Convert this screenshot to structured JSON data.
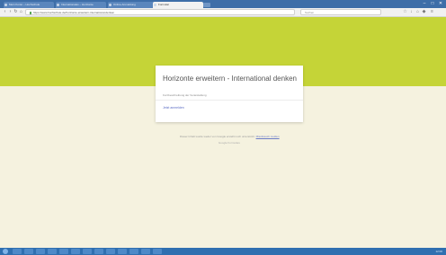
{
  "browser": {
    "tabs": [
      {
        "label": "Mein Konto – Hochschule"
      },
      {
        "label": "Internationales – Horizonte"
      },
      {
        "label": "Online-Anmeldung"
      },
      {
        "label": "Formular"
      }
    ],
    "window_controls": [
      "–",
      "□",
      "✕"
    ],
    "address": "https://www.hochschule.de/horizonte-erweitern-international-denken",
    "search_placeholder": "Suchen",
    "nav_icons": [
      "back-icon",
      "forward-icon",
      "reload-icon",
      "home-icon"
    ]
  },
  "colors": {
    "banner": "#c5d437",
    "background": "#f5f2df",
    "link": "#5b6cc4",
    "taskbar": "#2f6fb0"
  },
  "card": {
    "title": "Horizonte erweitern - International denken",
    "subtitle": "Kurzbeschreibung der Veranstaltung",
    "link": "Jetzt anmelden"
  },
  "footer": {
    "text": "Dieser Inhalt wurde weder von Google erstellt noch unterstützt.",
    "link": "Missbrauch melden",
    "small": "Google Formulare"
  },
  "taskbar": {
    "clock": "12:00"
  }
}
